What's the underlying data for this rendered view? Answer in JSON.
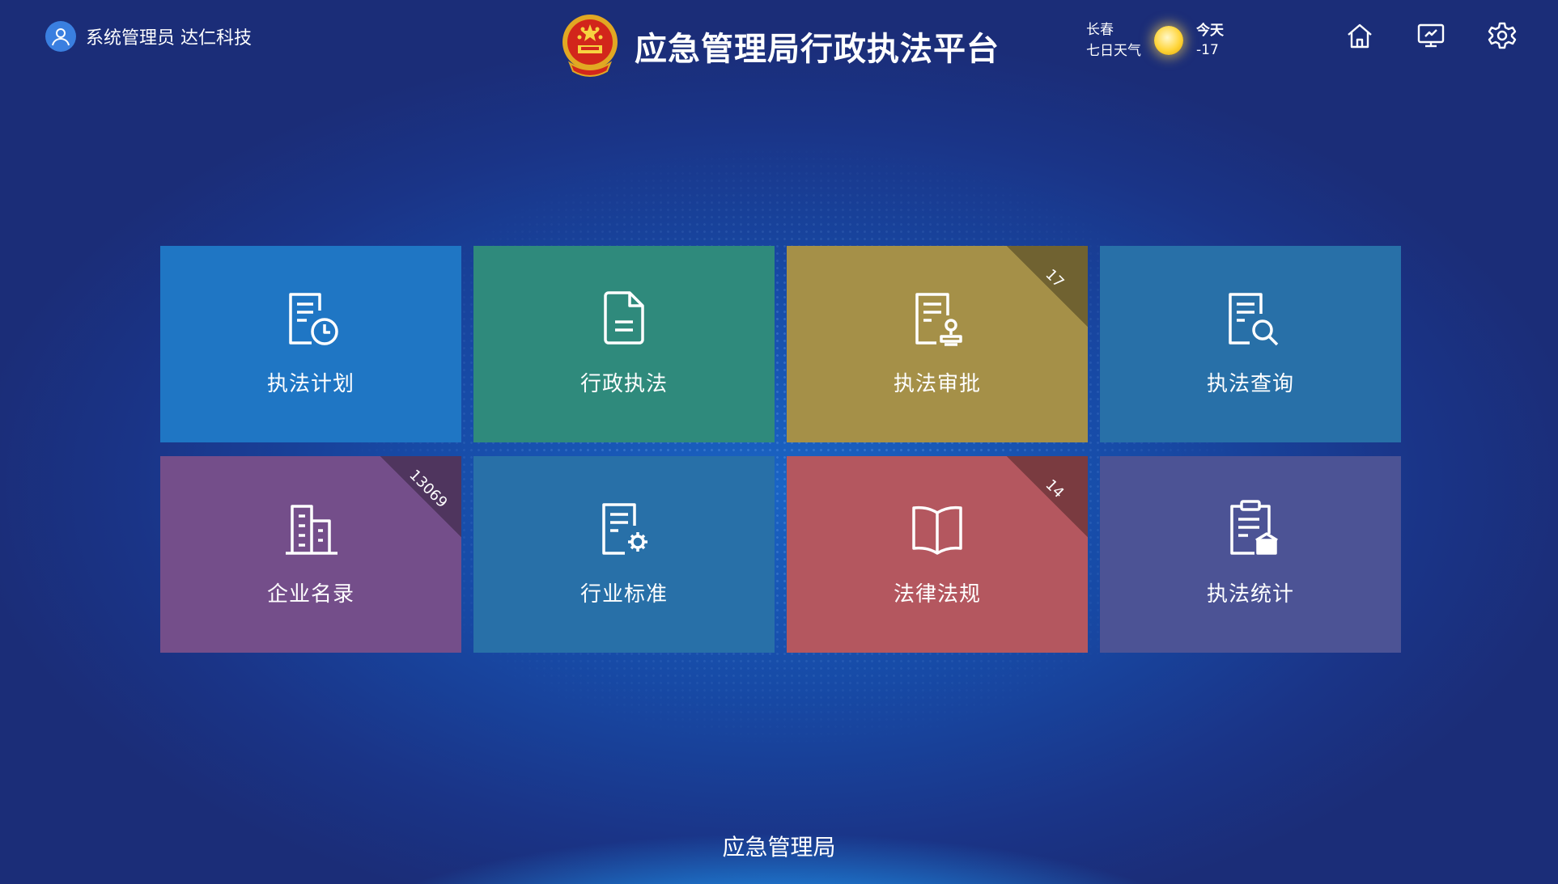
{
  "header": {
    "user_label": "系统管理员 达仁科技",
    "app_title": "应急管理局行政执法平台",
    "weather": {
      "city": "长春",
      "forecast_link": "七日天气",
      "today_label": "今天",
      "temperature": "-17",
      "icon": "sun-icon"
    },
    "icons": [
      "home-icon",
      "monitor-icon",
      "settings-icon"
    ]
  },
  "tiles": [
    {
      "label": "执法计划",
      "color": "#1f76c4",
      "icon": "doc-clock-icon",
      "badge": ""
    },
    {
      "label": "行政执法",
      "color": "#2f8a7c",
      "icon": "document-icon",
      "badge": ""
    },
    {
      "label": "执法审批",
      "color": "#a59048",
      "icon": "doc-stamp-icon",
      "badge": "17"
    },
    {
      "label": "执法查询",
      "color": "#2870a8",
      "icon": "doc-search-icon",
      "badge": ""
    },
    {
      "label": "企业名录",
      "color": "#744e8a",
      "icon": "building-icon",
      "badge": "13069"
    },
    {
      "label": "行业标准",
      "color": "#2870a8",
      "icon": "doc-gear-icon",
      "badge": ""
    },
    {
      "label": "法律法规",
      "color": "#b4575f",
      "icon": "book-icon",
      "badge": "14"
    },
    {
      "label": "执法统计",
      "color": "#4c5395",
      "icon": "clipboard-chart-icon",
      "badge": ""
    }
  ],
  "footer": {
    "text": "应急管理局"
  }
}
